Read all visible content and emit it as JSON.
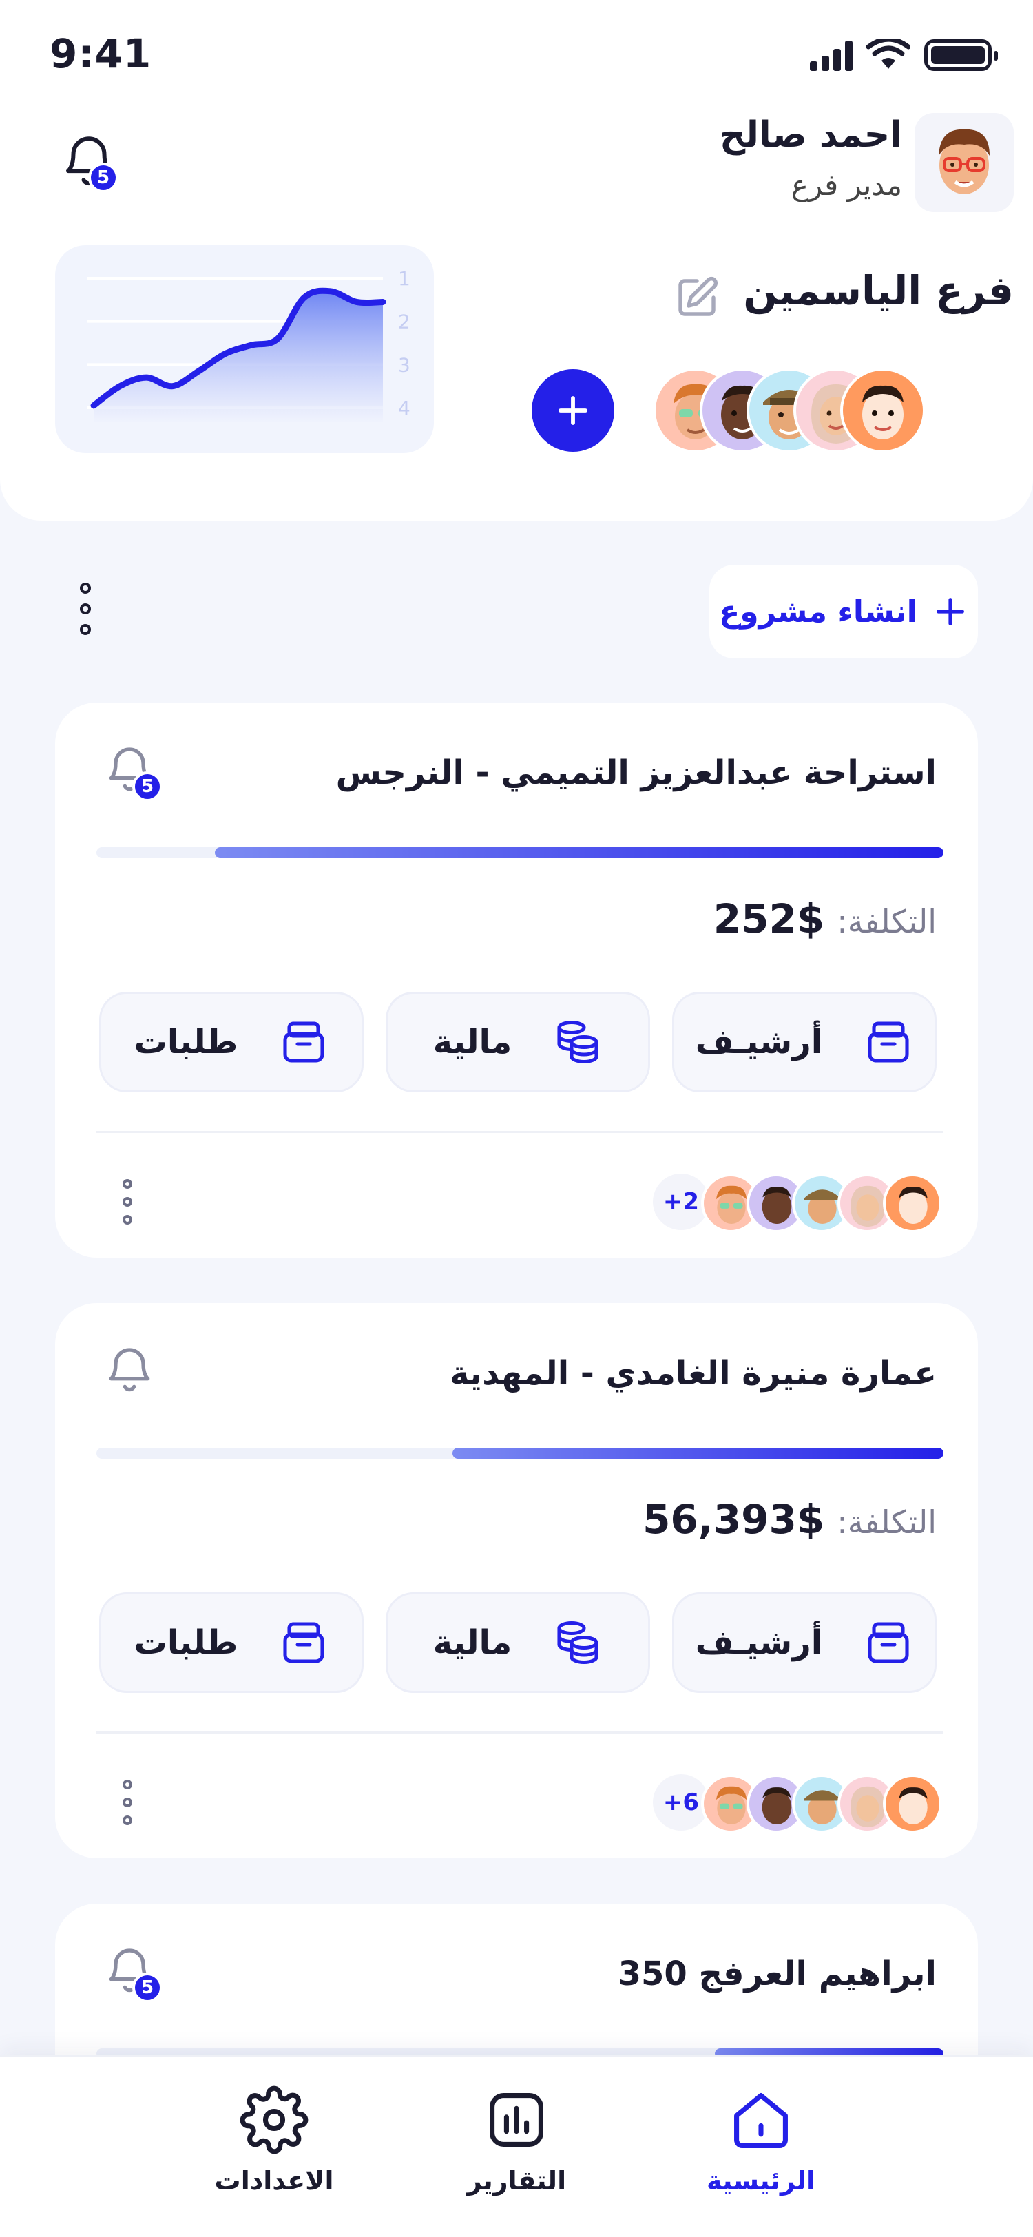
{
  "status_bar": {
    "time": "9:41"
  },
  "header": {
    "notification_count": "5",
    "user_name": "احمد صالح",
    "user_role": "مدير فرع",
    "branch_name": "فرع الياسمين",
    "chart_ticks": [
      "1",
      "2",
      "3",
      "4"
    ]
  },
  "chart_data": {
    "type": "area",
    "title": "",
    "xlabel": "",
    "ylabel": "",
    "y_ticks": [
      1,
      2,
      3,
      4
    ],
    "ylim": [
      1,
      4
    ],
    "y_reversed": true,
    "values": [
      3.95,
      3.5,
      3.3,
      3.5,
      3.15,
      2.75,
      2.55,
      2.4,
      1.45,
      1.3,
      1.55,
      1.55
    ],
    "grid": true,
    "colors": {
      "line": "#2420e8",
      "fill_top": "#6f86f3",
      "fill_bottom": "#eef1fd"
    }
  },
  "toolbar": {
    "create_project_label": "انشاء مشروع"
  },
  "projects": [
    {
      "title": "استراحة عبدالعزيز التميمي - النرجس",
      "has_notification": true,
      "notification_count": "5",
      "progress_percent": 86,
      "cost_label": "التكلفة:",
      "cost_value": "252$",
      "actions": [
        "أرشيـف",
        "مالية",
        "طلبات"
      ],
      "extra_members": "+2"
    },
    {
      "title": "عمارة منيرة الغامدي - المهدية",
      "has_notification": false,
      "progress_percent": 58,
      "cost_label": "التكلفة:",
      "cost_value": "56,393$",
      "actions": [
        "أرشيـف",
        "مالية",
        "طلبات"
      ],
      "extra_members": "+6"
    },
    {
      "title": "ابراهيم العرفج 350",
      "has_notification": true,
      "notification_count": "5",
      "progress_percent": 27
    }
  ],
  "bottom_nav": {
    "items": [
      {
        "label": "الرئيسية",
        "icon": "home-icon",
        "active": true
      },
      {
        "label": "التقارير",
        "icon": "reports-icon",
        "active": false
      },
      {
        "label": "الاعدادات",
        "icon": "gear-icon",
        "active": false
      }
    ]
  },
  "colors": {
    "accent": "#2420e8",
    "background": "#f4f6fc",
    "card": "#ffffff"
  }
}
